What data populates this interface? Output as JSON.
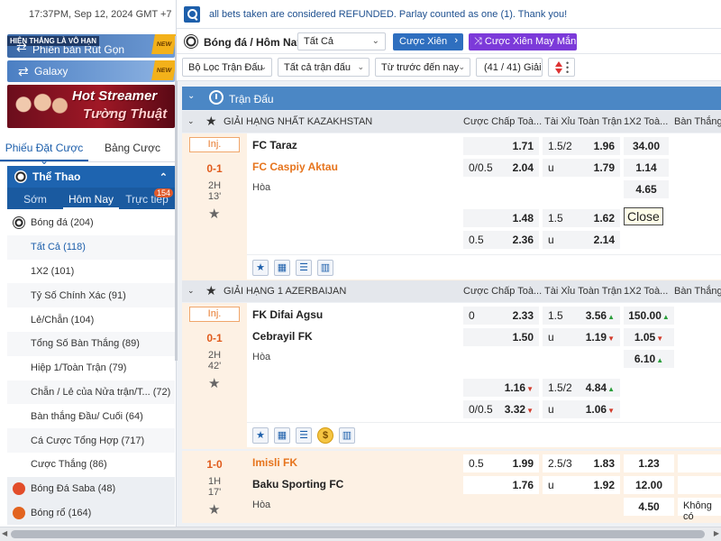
{
  "header": {
    "clock": "17:37PM, Sep 12, 2024 GMT +7",
    "notice": "all bets taken are considered REFUNDED. Parlay counted as one (1). Thank you!"
  },
  "promos": {
    "quick_tag": "HIỆN THẮNG LÀ VÔ HẠN",
    "quick_label": "Phiên bản Rút Gọn",
    "galaxy_label": "Galaxy",
    "new_badge": "NEW",
    "streamer_line1": "Hot Streamer",
    "streamer_line2": "Tường Thuật"
  },
  "sidebar": {
    "tabs": [
      "Phiếu Đặt Cược",
      "Bảng Cược"
    ],
    "sport_title": "Thể Thao",
    "day_tabs": [
      "Sớm",
      "Hôm Nay",
      "Trực tiếp"
    ],
    "live_count": "154",
    "items": [
      {
        "label": "Bóng đá (204)",
        "kind": "sport"
      },
      {
        "label": "Tất Cả (118)",
        "kind": "sub-active"
      },
      {
        "label": "1X2 (101)",
        "kind": "sub"
      },
      {
        "label": "Tỷ Số Chính Xác (91)",
        "kind": "sub"
      },
      {
        "label": "Lẻ/Chẵn (104)",
        "kind": "sub"
      },
      {
        "label": "Tổng Số Bàn Thắng (89)",
        "kind": "sub"
      },
      {
        "label": "Hiệp 1/Toàn Trận (79)",
        "kind": "sub"
      },
      {
        "label": "Chẵn / Lẻ của Nửa trận/T... (72)",
        "kind": "sub"
      },
      {
        "label": "Bàn thắng Đầu/ Cuối (64)",
        "kind": "sub"
      },
      {
        "label": "Cá Cược Tổng Hợp (717)",
        "kind": "sub"
      },
      {
        "label": "Cược Thắng (86)",
        "kind": "sub"
      },
      {
        "label": "Bóng Đá Saba (48)",
        "kind": "sport"
      },
      {
        "label": "Bóng rổ (164)",
        "kind": "sport"
      }
    ]
  },
  "toolbar": {
    "title": "Bóng đá / Hôm Nay",
    "select_value": "Tất Cả",
    "parlay_label": "Cược Xiên",
    "lucky_label": "Cược Xiên May Mắn",
    "filters": [
      "Bộ Lọc Trận Đấu",
      "Tất cả trận đấu",
      "Từ trước đến nay"
    ],
    "count": "(41 / 41) Giải"
  },
  "section": {
    "title": "Trận Đấu"
  },
  "columns": [
    "Cược Chấp Toà...",
    "Tài Xỉu Toàn Trận",
    "1X2 Toà...",
    "Bàn Thắng..."
  ],
  "leagues": [
    {
      "name": "GIẢI HẠNG NHẤT KAZAKHSTAN",
      "match": {
        "tag": "Inj.",
        "score": "0-1",
        "period": "2H",
        "minute": "13'",
        "home": "FC Taraz",
        "away": "FC Caspiy Aktau",
        "draw": "Hòa",
        "ft": [
          {
            "hdp": "",
            "hdp_odds": "1.71",
            "ou": "1.5/2",
            "ou_odds": "1.96",
            "x12": "34.00"
          },
          {
            "hdp": "0/0.5",
            "hdp_odds": "2.04",
            "ou": "u",
            "ou_odds": "1.79",
            "x12": "1.14"
          },
          {
            "x12": "4.65"
          }
        ],
        "alt": [
          {
            "hdp": "",
            "hdp_odds": "1.48",
            "ou": "1.5",
            "ou_odds": "1.62"
          },
          {
            "hdp": "0.5",
            "hdp_odds": "2.36",
            "ou": "u",
            "ou_odds": "2.14"
          }
        ],
        "tooltip": "Close"
      }
    },
    {
      "name": "GIẢI HẠNG 1 AZERBAIJAN",
      "match": {
        "tag": "Inj.",
        "score": "0-1",
        "period": "2H",
        "minute": "42'",
        "home": "FK Difai Agsu",
        "away": "Cebrayil FK",
        "draw": "Hòa",
        "ft": [
          {
            "hdp": "0",
            "hdp_odds": "2.33",
            "ou": "1.5",
            "ou_odds": "3.56",
            "x12": "150.00"
          },
          {
            "hdp": "",
            "hdp_odds": "1.50",
            "ou": "u",
            "ou_odds": "1.19",
            "x12": "1.05"
          },
          {
            "x12": "6.10"
          }
        ],
        "alt": [
          {
            "hdp": "",
            "hdp_odds": "1.16",
            "ou": "1.5/2",
            "ou_odds": "4.84"
          },
          {
            "hdp": "0/0.5",
            "hdp_odds": "3.32",
            "ou": "u",
            "ou_odds": "1.06"
          }
        ]
      }
    }
  ],
  "match3": {
    "score": "1-0",
    "period": "1H",
    "minute": "17'",
    "home": "Imisli FK",
    "away": "Baku Sporting FC",
    "draw": "Hòa",
    "rows": [
      {
        "hdp": "0.5",
        "hdp_odds": "1.99",
        "ou": "2.5/3",
        "ou_odds": "1.83",
        "x12": "1.23"
      },
      {
        "hdp": "",
        "hdp_odds": "1.76",
        "ou": "u",
        "ou_odds": "1.92",
        "x12": "12.00"
      },
      {
        "x12": "4.50",
        "extra": "Không có"
      }
    ]
  },
  "colors": {
    "brand": "#1d5fab",
    "accent": "#e6741d",
    "lucky": "#7c3ad9"
  }
}
